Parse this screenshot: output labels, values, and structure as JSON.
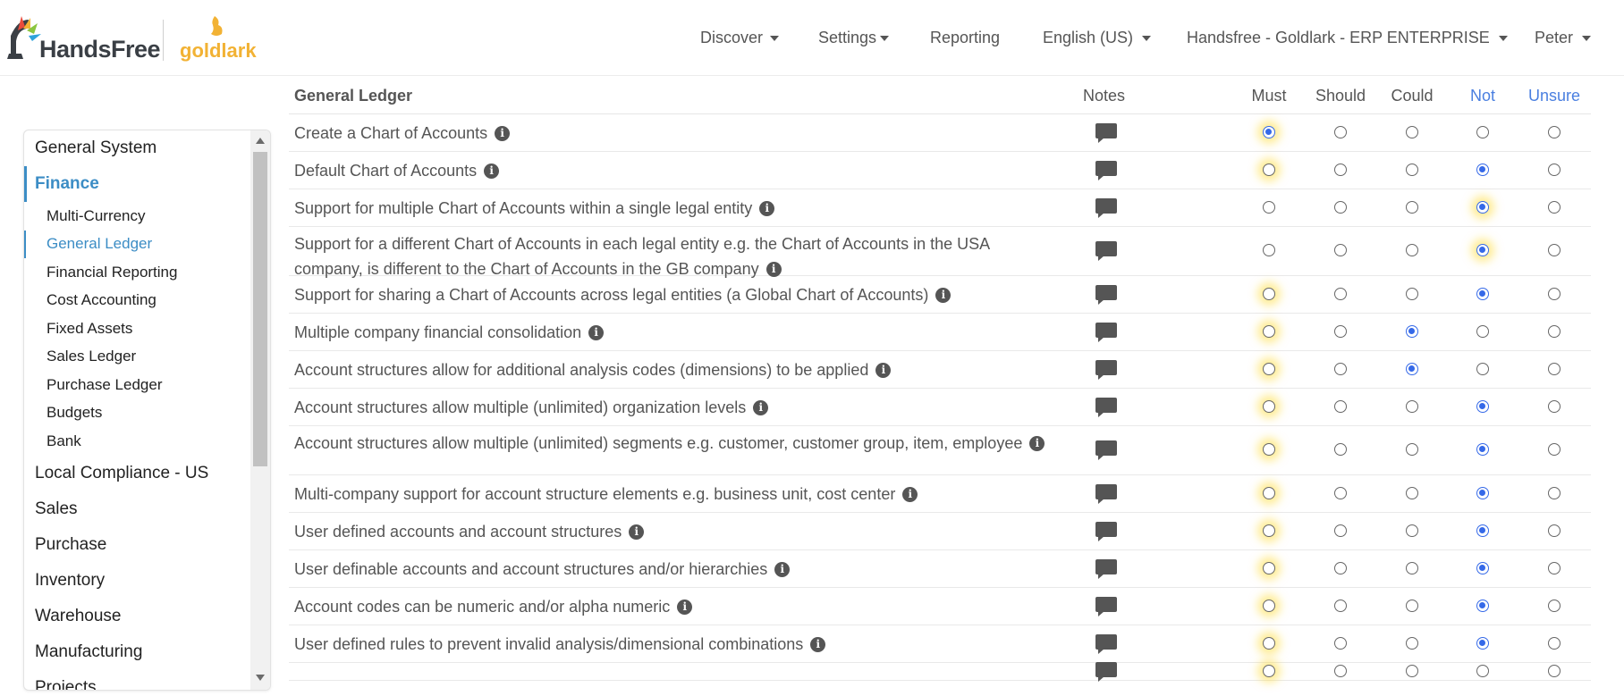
{
  "brand": {
    "left": "HandsFree",
    "right": "goldlark"
  },
  "nav": [
    {
      "label": "Discover",
      "dropdown": true
    },
    {
      "label": "Settings",
      "dropdown": true
    },
    {
      "label": "Reporting",
      "dropdown": false
    },
    {
      "label": "English (US)",
      "dropdown": true
    },
    {
      "label": "Handsfree - Goldlark - ERP ENTERPRISE",
      "dropdown": true
    },
    {
      "label": "Peter",
      "dropdown": true
    }
  ],
  "sidebar": {
    "items": [
      {
        "label": "General System",
        "level": 1,
        "active": false
      },
      {
        "label": "Finance",
        "level": 1,
        "active": true
      },
      {
        "label": "Multi-Currency",
        "level": 2,
        "active": false
      },
      {
        "label": "General Ledger",
        "level": 2,
        "active": true
      },
      {
        "label": "Financial Reporting",
        "level": 2,
        "active": false
      },
      {
        "label": "Cost Accounting",
        "level": 2,
        "active": false
      },
      {
        "label": "Fixed Assets",
        "level": 2,
        "active": false
      },
      {
        "label": "Sales Ledger",
        "level": 2,
        "active": false
      },
      {
        "label": "Purchase Ledger",
        "level": 2,
        "active": false
      },
      {
        "label": "Budgets",
        "level": 2,
        "active": false
      },
      {
        "label": "Bank",
        "level": 2,
        "active": false
      },
      {
        "label": "Local Compliance - US",
        "level": 1,
        "active": false
      },
      {
        "label": "Sales",
        "level": 1,
        "active": false
      },
      {
        "label": "Purchase",
        "level": 1,
        "active": false
      },
      {
        "label": "Inventory",
        "level": 1,
        "active": false
      },
      {
        "label": "Warehouse",
        "level": 1,
        "active": false
      },
      {
        "label": "Manufacturing",
        "level": 1,
        "active": false
      },
      {
        "label": "Projects",
        "level": 1,
        "active": false
      }
    ]
  },
  "table": {
    "title": "General Ledger",
    "notes_header": "Notes",
    "columns": [
      "Must",
      "Should",
      "Could",
      "Not",
      "Unsure"
    ],
    "column_colors": [
      "#555555",
      "#555555",
      "#555555",
      "#4a7fe0",
      "#4a7fe0"
    ],
    "highlight_color": "#ffd83c",
    "radio_color": "#3569e8",
    "rows": [
      {
        "text": "Create a Chart of Accounts",
        "selected": "Must",
        "highlight": "Must"
      },
      {
        "text": "Default Chart of Accounts",
        "selected": "Not",
        "highlight": "Must"
      },
      {
        "text": "Support for multiple Chart of Accounts within a single legal entity",
        "selected": "Not",
        "highlight": "Not"
      },
      {
        "text": "Support for a different Chart of Accounts in each legal entity e.g. the Chart of Accounts in the USA company, is different to the Chart of Accounts in the GB company",
        "selected": "Not",
        "highlight": "Not"
      },
      {
        "text": "Support for sharing a Chart of Accounts across legal entities (a Global Chart of Accounts)",
        "selected": "Not",
        "highlight": "Must"
      },
      {
        "text": "Multiple company financial consolidation",
        "selected": "Could",
        "highlight": "Must"
      },
      {
        "text": "Account structures allow for additional analysis codes (dimensions) to be applied",
        "selected": "Could",
        "highlight": "Must"
      },
      {
        "text": "Account structures allow multiple (unlimited) organization levels",
        "selected": "Not",
        "highlight": "Must"
      },
      {
        "text": "Account structures allow multiple (unlimited) segments e.g. customer, customer group, item, employee",
        "selected": "Not",
        "highlight": "Must"
      },
      {
        "text": "Multi-company support for account structure elements e.g. business unit, cost center",
        "selected": "Not",
        "highlight": "Must"
      },
      {
        "text": "User defined accounts and account structures",
        "selected": "Not",
        "highlight": "Must"
      },
      {
        "text": "User definable accounts and account structures and/or hierarchies",
        "selected": "Not",
        "highlight": "Must"
      },
      {
        "text": "Account codes can be numeric and/or alpha numeric",
        "selected": "Not",
        "highlight": "Must"
      },
      {
        "text": "User defined rules to prevent invalid analysis/dimensional combinations",
        "selected": "Not",
        "highlight": "Must"
      },
      {
        "text": "",
        "selected": "",
        "highlight": "Must"
      }
    ]
  }
}
